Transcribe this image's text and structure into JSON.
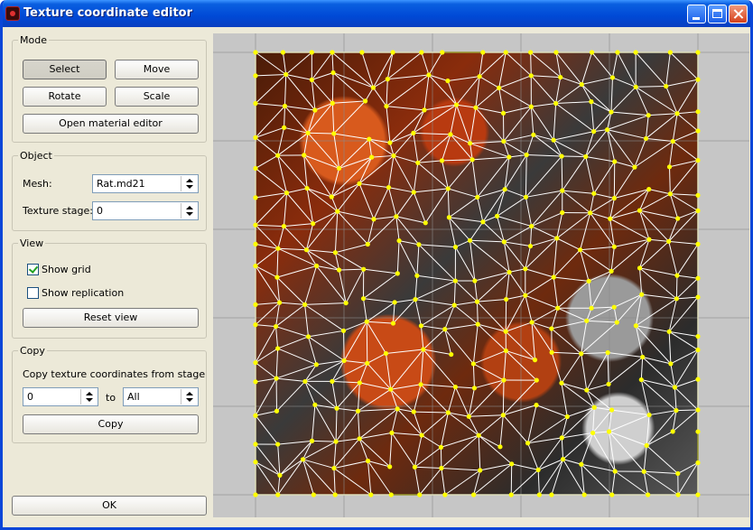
{
  "window": {
    "title": "Texture coordinate editor"
  },
  "mode": {
    "legend": "Mode",
    "select": "Select",
    "move": "Move",
    "rotate": "Rotate",
    "scale": "Scale",
    "open_material_editor": "Open material editor"
  },
  "object": {
    "legend": "Object",
    "mesh_label": "Mesh:",
    "mesh_value": "Rat.md21",
    "texture_stage_label": "Texture stage:",
    "texture_stage_value": "0"
  },
  "view": {
    "legend": "View",
    "show_grid": "Show grid",
    "show_grid_checked": true,
    "show_replication": "Show replication",
    "show_replication_checked": false,
    "reset_view": "Reset view"
  },
  "copy": {
    "legend": "Copy",
    "description": "Copy texture coordinates from stage",
    "from_value": "0",
    "to_label": "to",
    "to_value": "All",
    "copy_button": "Copy"
  },
  "footer": {
    "ok": "OK"
  },
  "colors": {
    "vertex": "#ffff00",
    "edge": "#ffffff",
    "grid": "#8a8a8a",
    "border": "#9a9a30"
  },
  "icons": [
    "app-icon",
    "minimize-icon",
    "maximize-icon",
    "close-icon",
    "spin-up-icon",
    "spin-down-icon",
    "checkmark-icon"
  ]
}
